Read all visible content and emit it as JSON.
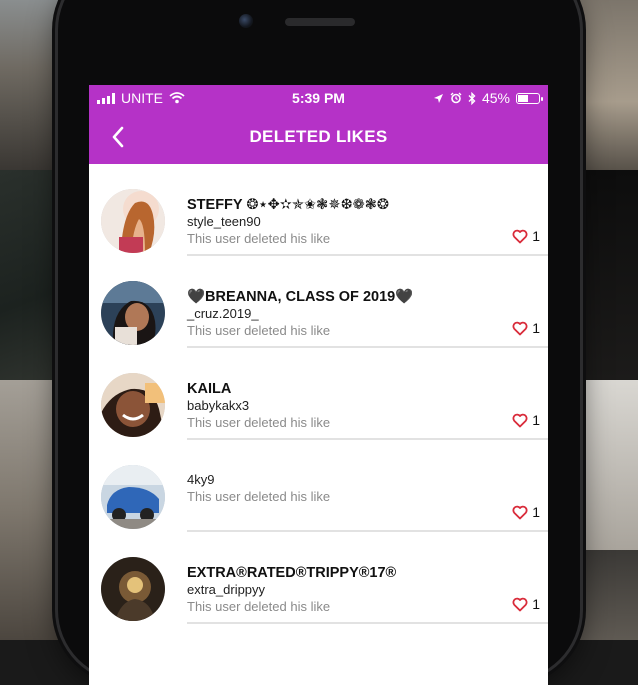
{
  "status_bar": {
    "carrier": "UNITE",
    "time": "5:39 PM",
    "battery_percent": "45%",
    "battery_level": 0.45
  },
  "nav": {
    "title": "DELETED LIKES"
  },
  "list": [
    {
      "name": "STEFFY ❂⋆✥✫✯✬❃✵❆❁❃❂",
      "username": "style_teen90",
      "status": "This user deleted his like",
      "likes": "1"
    },
    {
      "name": "🖤BREANNA, CLASS OF 2019🖤",
      "username": "_cruz.2019_",
      "status": "This user deleted his like",
      "likes": "1"
    },
    {
      "name": "KAILA",
      "username": "babykakx3",
      "status": "This user deleted his like",
      "likes": "1"
    },
    {
      "name": "",
      "username": "4ky9",
      "status": "This user deleted his like",
      "likes": "1"
    },
    {
      "name": "EXTRA®RATED®TRIPPY®17®",
      "username": "extra_drippyy",
      "status": "This user deleted his like",
      "likes": "1"
    }
  ],
  "colors": {
    "accent": "#b532c7",
    "heart": "#d92b3a"
  }
}
